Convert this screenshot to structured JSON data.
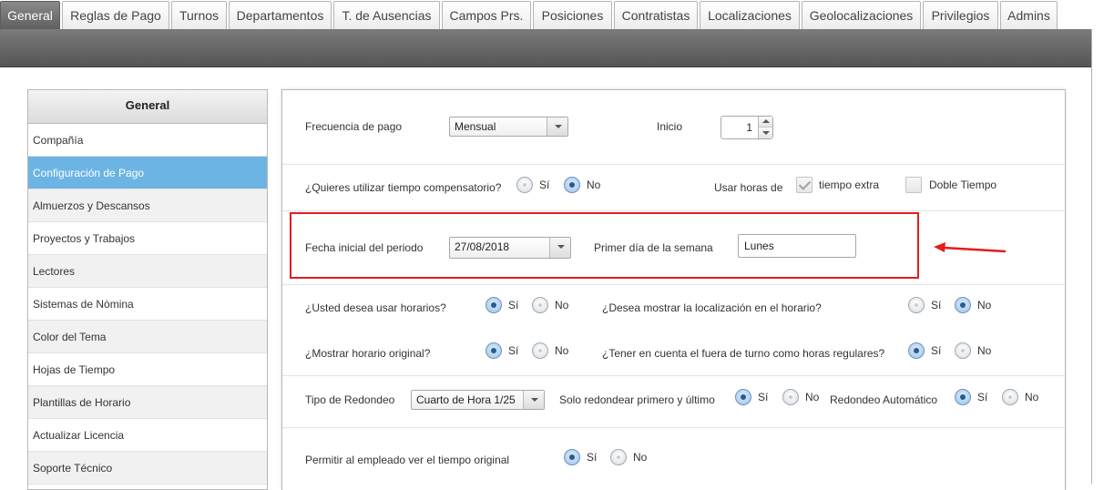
{
  "tabs": [
    {
      "label": "General",
      "active": true
    },
    {
      "label": "Reglas de Pago"
    },
    {
      "label": "Turnos"
    },
    {
      "label": "Departamentos"
    },
    {
      "label": "T. de Ausencias"
    },
    {
      "label": "Campos Prs."
    },
    {
      "label": "Posiciones"
    },
    {
      "label": "Contratistas"
    },
    {
      "label": "Localizaciones"
    },
    {
      "label": "Geolocalizaciones"
    },
    {
      "label": "Privilegios"
    },
    {
      "label": "Admins"
    }
  ],
  "sidebar": {
    "title": "General",
    "items": [
      {
        "label": "Compañía"
      },
      {
        "label": "Configuración de Pago",
        "active": true
      },
      {
        "label": "Almuerzos y Descansos"
      },
      {
        "label": "Proyectos y Trabajos"
      },
      {
        "label": "Lectores"
      },
      {
        "label": "Sistemas de Nòmina"
      },
      {
        "label": "Color del Tema"
      },
      {
        "label": "Hojas de Tiempo"
      },
      {
        "label": "Plantillas de Horario"
      },
      {
        "label": "Actualizar Licencia"
      },
      {
        "label": "Soporte Técnico"
      }
    ]
  },
  "form": {
    "pay_frequency": {
      "label": "Frecuencia de pago",
      "value": "Mensual"
    },
    "start": {
      "label": "Inicio",
      "value": "1"
    },
    "comp_time": {
      "label": "¿Quieres utilizar tiempo compensatorio?",
      "yes": "Sí",
      "no": "No",
      "selected": "no"
    },
    "use_hours": {
      "label": "Usar horas de",
      "overtime": "tiempo extra",
      "overtime_checked": true,
      "double_time": "Doble Tiempo",
      "double_checked": false
    },
    "period_start": {
      "label": "Fecha inicial del periodo",
      "value": "27/08/2018"
    },
    "first_day": {
      "label": "Primer día de la semana",
      "value": "Lunes"
    },
    "use_schedules": {
      "label": "¿Usted desea usar horarios?",
      "yes": "Sí",
      "no": "No",
      "selected": "yes"
    },
    "show_location": {
      "label": "¿Desea mostrar la localización en el horario?",
      "yes": "Sí",
      "no": "No",
      "selected": "no"
    },
    "show_original": {
      "label": "¿Mostrar horario original?",
      "yes": "Sí",
      "no": "No",
      "selected": "yes"
    },
    "off_shift": {
      "label": "¿Tener en cuenta el fuera de turno como horas regulares?",
      "yes": "Sí",
      "no": "No",
      "selected": "yes"
    },
    "rounding": {
      "label": "Tipo de Redondeo",
      "value": "Cuarto de Hora 1/25"
    },
    "round_first_last": {
      "label": "Solo redondear primero y último",
      "yes": "Sí",
      "no": "No",
      "selected": "yes"
    },
    "auto_round": {
      "label": "Redondeo Automático",
      "yes": "Sí",
      "no": "No",
      "selected": "yes"
    },
    "employee_view": {
      "label": "Permitir al empleado ver el tiempo original",
      "yes": "Sí",
      "no": "No",
      "selected": "yes"
    }
  },
  "colors": {
    "accent": "#6cb4e4",
    "annotation": "#e41c1c",
    "toolbar": "#666666"
  }
}
